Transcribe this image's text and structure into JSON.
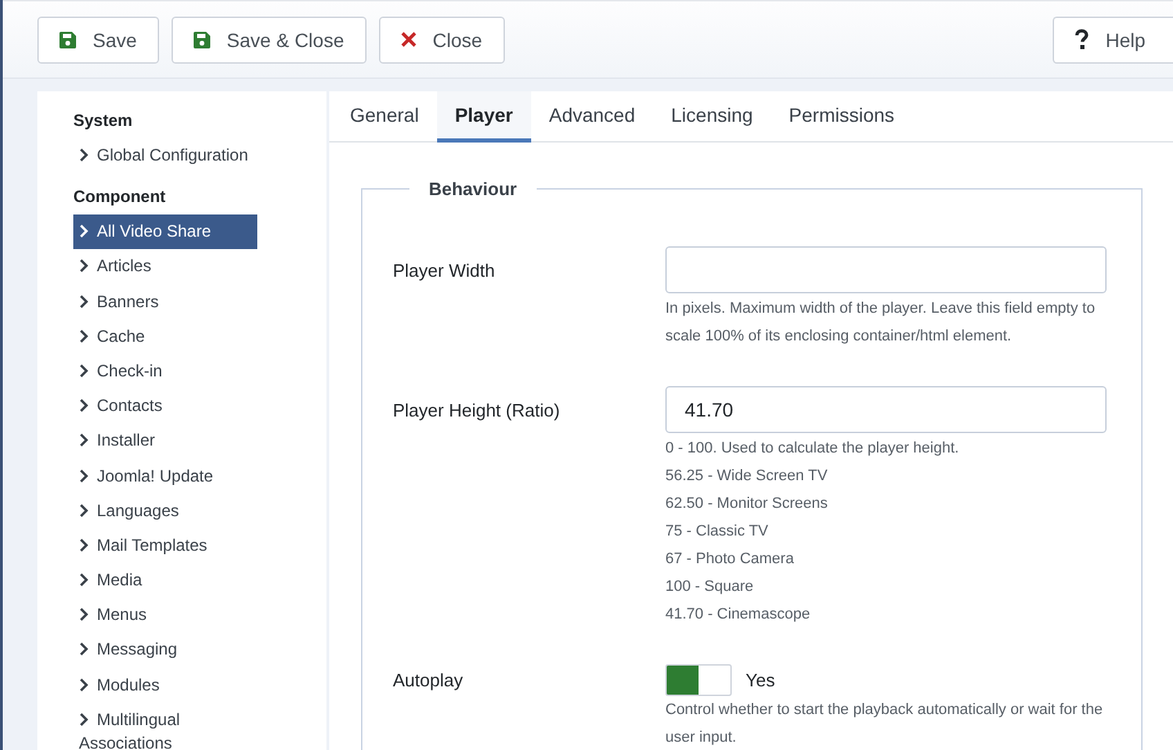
{
  "toolbar": {
    "buttons": [
      {
        "kind": "save",
        "label": "Save"
      },
      {
        "kind": "save",
        "label": "Save & Close"
      },
      {
        "kind": "close",
        "label": "Close"
      }
    ],
    "help": {
      "kind": "help",
      "label": "Help"
    }
  },
  "sidebar": {
    "sections": [
      {
        "title": "System",
        "items": [
          {
            "label": "Global Configuration",
            "selected": false
          }
        ]
      },
      {
        "title": "Component",
        "items": [
          {
            "label": "All Video Share",
            "selected": true
          },
          {
            "label": "Articles",
            "selected": false
          },
          {
            "label": "Banners",
            "selected": false
          },
          {
            "label": "Cache",
            "selected": false
          },
          {
            "label": "Check-in",
            "selected": false
          },
          {
            "label": "Contacts",
            "selected": false
          },
          {
            "label": "Installer",
            "selected": false
          },
          {
            "label": "Joomla! Update",
            "selected": false
          },
          {
            "label": "Languages",
            "selected": false
          },
          {
            "label": "Mail Templates",
            "selected": false
          },
          {
            "label": "Media",
            "selected": false
          },
          {
            "label": "Menus",
            "selected": false
          },
          {
            "label": "Messaging",
            "selected": false
          },
          {
            "label": "Modules",
            "selected": false
          },
          {
            "label": "Multilingual Associations",
            "selected": false
          }
        ]
      }
    ]
  },
  "tabs": [
    {
      "label": "General",
      "selected": false
    },
    {
      "label": "Player",
      "selected": true
    },
    {
      "label": "Advanced",
      "selected": false
    },
    {
      "label": "Licensing",
      "selected": false
    },
    {
      "label": "Permissions",
      "selected": false
    }
  ],
  "fieldset": {
    "legend": "Behaviour",
    "fields": [
      {
        "kind": "text",
        "label": "Player Width",
        "help": [
          "In pixels. Maximum width of the player. Leave this field empty to scale 100% of its enclosing container/html element."
        ]
      },
      {
        "kind": "text",
        "label": "Player Height (Ratio)",
        "value": "41.70",
        "help": [
          "0 - 100. Used to calculate the player height.",
          "56.25 - Wide Screen TV",
          "62.50 - Monitor Screens",
          "75 - Classic TV",
          "67 - Photo Camera",
          "100 - Square",
          "41.70 - Cinemascope"
        ]
      },
      {
        "kind": "toggle",
        "label": "Autoplay",
        "on": true,
        "state_label": "Yes",
        "help": [
          "Control whether to start the playback automatically or wait for the user input."
        ]
      }
    ]
  }
}
